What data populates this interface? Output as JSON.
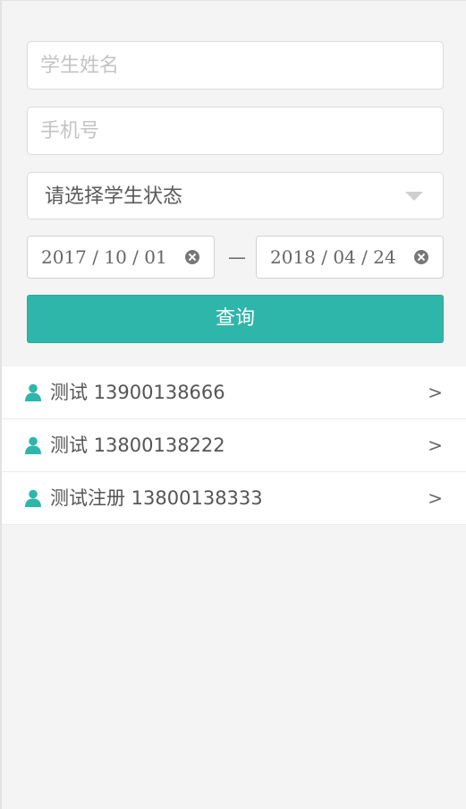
{
  "search_form": {
    "name_placeholder": "学生姓名",
    "name_value": "",
    "phone_placeholder": "手机号",
    "phone_value": "",
    "status_select": "请选择学生状态",
    "date_start": "2017 / 10 / 01",
    "date_end": "2018 / 04 / 24",
    "date_separator": "—",
    "query_label": "查询"
  },
  "students": [
    {
      "name": "测试 13900138666",
      "chevron": ">"
    },
    {
      "name": "测试 13800138222",
      "chevron": ">"
    },
    {
      "name": "测试注册 13800138333",
      "chevron": ">"
    }
  ],
  "colors": {
    "accent": "#2eb6aa",
    "background": "#f4f4f4"
  },
  "icons": {
    "row_icon": "user-icon",
    "clear_icon": "clear-icon",
    "select_icon": "caret-down-icon"
  }
}
